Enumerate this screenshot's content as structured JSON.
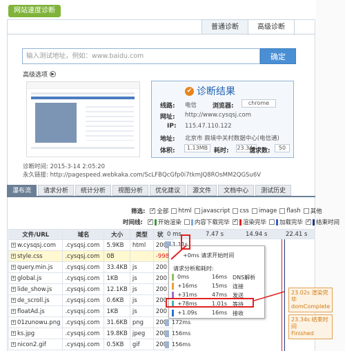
{
  "header_title": "网站速度诊断",
  "mode_tabs": [
    "普通诊断",
    "高级诊断"
  ],
  "url_input": {
    "placeholder": "输入测试地址，例如：www.baidu.com",
    "button": "确定"
  },
  "advanced_options": "高级选项",
  "result": {
    "title": "诊断结果",
    "line_label": "线路:",
    "line_value": "电信",
    "browser_label": "浏览器:",
    "browser_value": "chrome",
    "site_label": "网址:",
    "site_value": "http://www.cysqsj.com",
    "ip_label": "IP:",
    "ip_value": "115.47.110.122",
    "location_label": "地址:",
    "location_value": "北京市 鼎境中关村数据中心(电信通)",
    "size_label": "体积:",
    "size_value": "1.13MB",
    "time_label": "耗时:",
    "time_value": "23.34s",
    "requests_label": "请求数:",
    "requests_value": "50"
  },
  "diagnose_time": "诊断时间: 2015-3-14 2:05:20",
  "permalink": "永久链接: http://pagespeed.webkaka.com/ScLFBQcGfp0i7tkmJQ8ROsMM2QGSu6V",
  "main_tabs": [
    "瀑布流",
    "请求分析",
    "统计分析",
    "视图分析",
    "优化建议",
    "源文件",
    "文档中心",
    "测试历史"
  ],
  "filter": {
    "label": "筛选:",
    "options": [
      {
        "label": "全部",
        "checked": true
      },
      {
        "label": "html",
        "checked": false
      },
      {
        "label": "javascript",
        "checked": false
      },
      {
        "label": "css",
        "checked": false
      },
      {
        "label": "image",
        "checked": false
      },
      {
        "label": "flash",
        "checked": false
      },
      {
        "label": "其他",
        "checked": false
      }
    ]
  },
  "timeline_filter": {
    "label": "时间线:",
    "options": [
      {
        "label": "开始渲染",
        "checked": true,
        "color": "#3a9a3a"
      },
      {
        "label": "内容下载完毕",
        "checked": false,
        "color": "#7aa8e0"
      },
      {
        "label": "渲染完毕",
        "checked": true,
        "color": "#e02020"
      },
      {
        "label": "加载完毕",
        "checked": false,
        "color": "#3060c0"
      },
      {
        "label": "结束时间",
        "checked": true,
        "color": "#203880"
      }
    ]
  },
  "table": {
    "headers": [
      "文件/URL",
      "域名",
      "大小",
      "类型",
      "状态"
    ],
    "rows": [
      {
        "file": "w.cysqsj.com",
        "domain": ".cysqsj.com",
        "size": "5.9KB",
        "type": "html",
        "status": "200"
      },
      {
        "file": "style.css",
        "domain": ".cysqsj.com",
        "size": "0B",
        "type": "",
        "status": "-998"
      },
      {
        "file": "query.min.js",
        "domain": ".cysqsj.com",
        "size": "33.4KB",
        "type": "js",
        "status": "200"
      },
      {
        "file": "global.js",
        "domain": ".cysqsj.com",
        "size": "1KB",
        "type": "js",
        "status": "200"
      },
      {
        "file": "lide_show.js",
        "domain": ".cysqsj.com",
        "size": "12.1KB",
        "type": "js",
        "status": "200"
      },
      {
        "file": "de_scroll.js",
        "domain": ".cysqsj.com",
        "size": "0.6KB",
        "type": "js",
        "status": "200"
      },
      {
        "file": "floatAd.js",
        "domain": ".cysqsj.com",
        "size": "1KB",
        "type": "js",
        "status": "200"
      },
      {
        "file": "01zunowu.png",
        "domain": ".cysqsj.com",
        "size": "31.6KB",
        "type": "png",
        "status": "200"
      },
      {
        "file": "ks.jpg",
        "domain": ".cysqsj.com",
        "size": "19.8KB",
        "type": "jpeg",
        "status": "200"
      },
      {
        "file": "nicon2.gif",
        "domain": ".cysqsj.com",
        "size": "0.5KB",
        "type": "gif",
        "status": "200"
      }
    ]
  },
  "timeline": {
    "ticks": [
      "0 ms",
      "7.47 s",
      "14.94 s",
      "22.41 s"
    ],
    "bar_labels": [
      "1.11s",
      "172ms",
      "156ms",
      "156ms"
    ]
  },
  "popup": {
    "first": "+0ms 请求开始时间",
    "section": "请求分析和耗时:",
    "rows": [
      {
        "start": "0ms",
        "dur": "16ms",
        "name": "DNS解析",
        "color": "#8fc55a"
      },
      {
        "start": "+16ms",
        "dur": "15ms",
        "name": "连接",
        "color": "#e8a040"
      },
      {
        "start": "+31ms",
        "dur": "47ms",
        "name": "发送",
        "color": "#9b6fd0"
      },
      {
        "start": "+78ms",
        "dur": "1.01s",
        "name": "等待",
        "color": "#4ab0b0"
      },
      {
        "start": "+1.09s",
        "dur": "16ms",
        "name": "接收",
        "color": "#3070d0"
      }
    ]
  },
  "callouts": [
    {
      "line1": "23.02s 渲染完毕",
      "line2": "domComplete"
    },
    {
      "line1": "23.34s 结束时间",
      "line2": "Finished"
    }
  ]
}
